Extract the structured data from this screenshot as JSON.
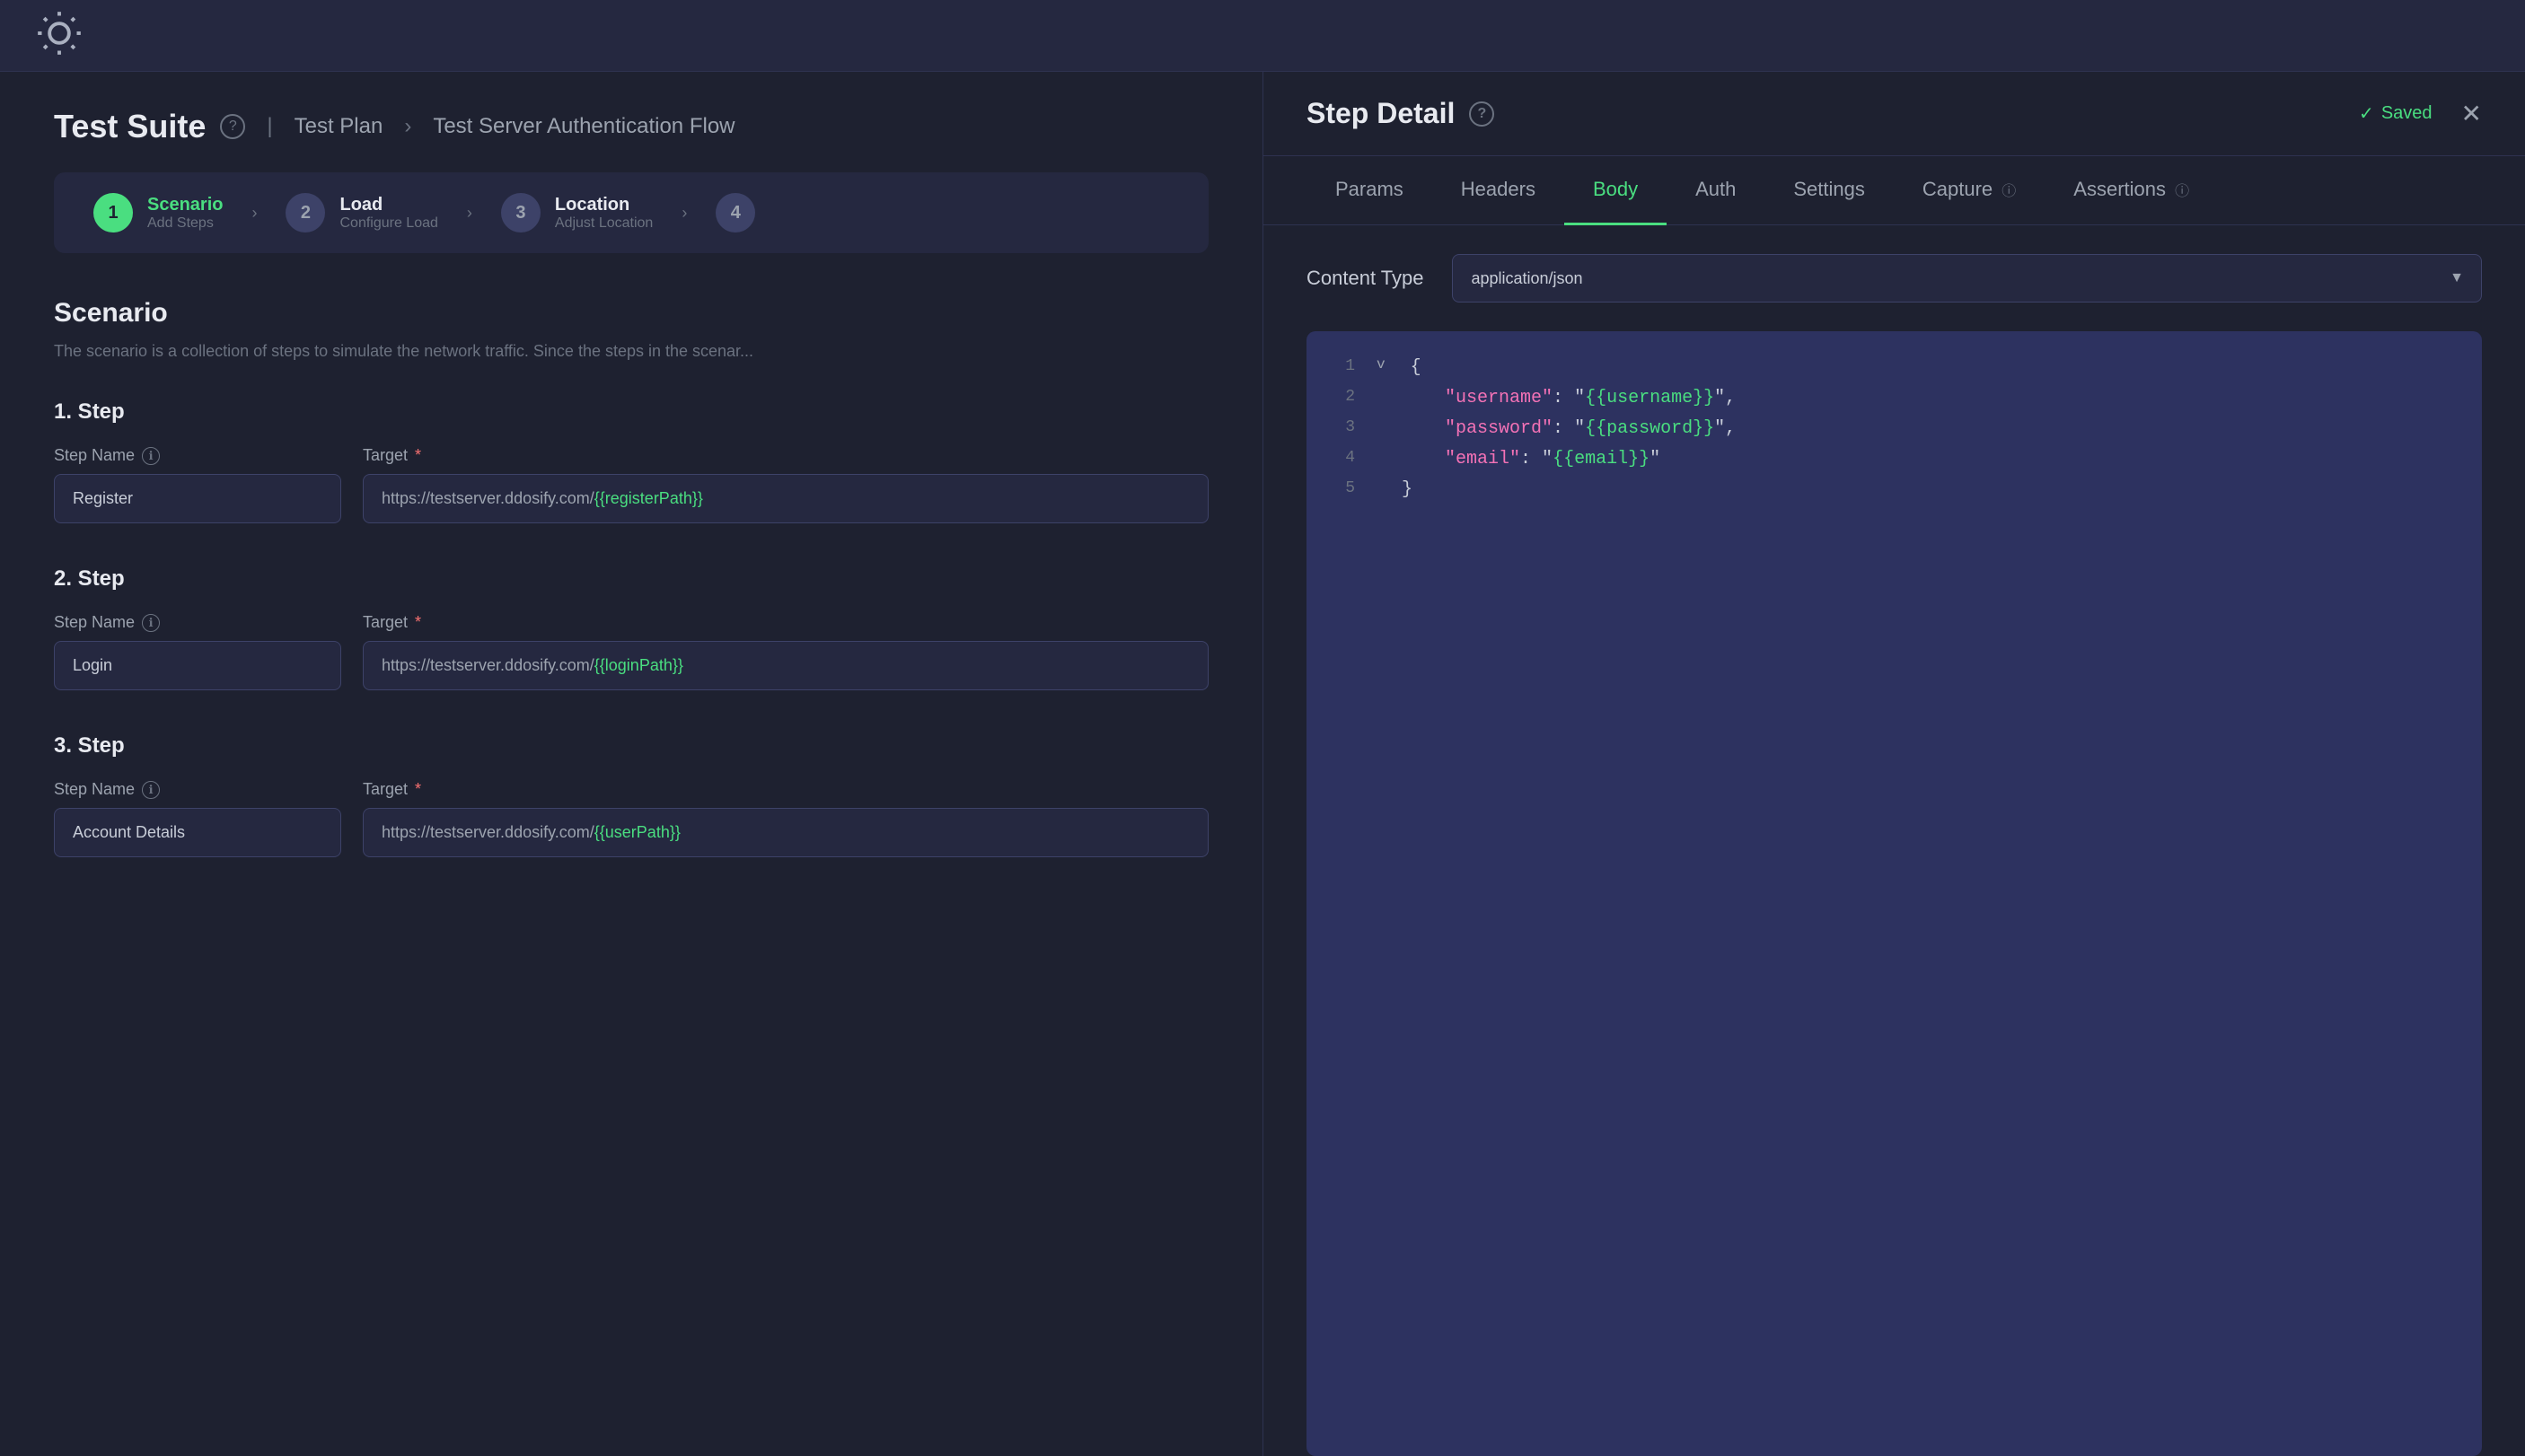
{
  "topbar": {
    "icon": "sun"
  },
  "breadcrumb": {
    "title": "Test Suite",
    "separator": ">",
    "plan": "Test Plan",
    "current": "Test Server Authentication Flow"
  },
  "stepsNav": {
    "items": [
      {
        "num": "1",
        "name": "Scenario",
        "sub": "Add Steps",
        "active": true
      },
      {
        "num": "2",
        "name": "Load",
        "sub": "Configure Load",
        "active": false
      },
      {
        "num": "3",
        "name": "Location",
        "sub": "Adjust Location",
        "active": false
      },
      {
        "num": "4",
        "name": "",
        "sub": "",
        "active": false
      }
    ]
  },
  "scenario": {
    "title": "Scenario",
    "description": "The scenario is a collection of steps to simulate the network traffic. Since the steps in the scenar..."
  },
  "steps": [
    {
      "num": "1",
      "nameLabel": "Step Name",
      "nameValue": "Register",
      "targetLabel": "Target*",
      "targetBase": "https://testserver.ddosify.com/",
      "targetTemplate": "{{registerPath}}"
    },
    {
      "num": "2",
      "nameLabel": "Step Name",
      "nameValue": "Login",
      "targetLabel": "Target*",
      "targetBase": "https://testserver.ddosify.com/",
      "targetTemplate": "{{loginPath}}"
    },
    {
      "num": "3",
      "nameLabel": "Step Name",
      "nameValue": "Account Details",
      "targetLabel": "Target*",
      "targetBase": "https://testserver.ddosify.com/",
      "targetTemplate": "{{userPath}}"
    }
  ],
  "stepDetail": {
    "title": "Step Detail",
    "saved": "Saved",
    "tabs": [
      {
        "id": "params",
        "label": "Params",
        "active": false
      },
      {
        "id": "headers",
        "label": "Headers",
        "active": false
      },
      {
        "id": "body",
        "label": "Body",
        "active": true
      },
      {
        "id": "auth",
        "label": "Auth",
        "active": false
      },
      {
        "id": "settings",
        "label": "Settings",
        "active": false
      },
      {
        "id": "capture",
        "label": "Capture",
        "active": false,
        "hasInfo": true
      },
      {
        "id": "assertions",
        "label": "Assertions",
        "active": false,
        "hasInfo": true
      }
    ],
    "contentType": {
      "label": "Content Type",
      "value": "application/json"
    },
    "code": {
      "lines": [
        {
          "num": "1",
          "indicator": "v",
          "content": "{"
        },
        {
          "num": "2",
          "indicator": "",
          "content": "  \"username\": \"{{username}}\","
        },
        {
          "num": "3",
          "indicator": "",
          "content": "  \"password\": \"{{password}}\","
        },
        {
          "num": "4",
          "indicator": "",
          "content": "  \"email\": \"{{email}}\""
        },
        {
          "num": "5",
          "indicator": "",
          "content": "}"
        }
      ]
    }
  }
}
